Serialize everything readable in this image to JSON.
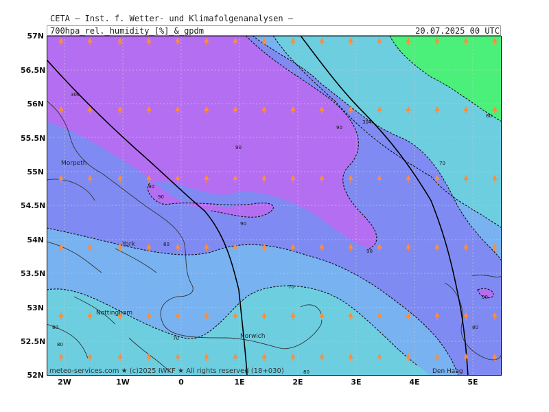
{
  "header": {
    "title": "CETA — Inst. f. Wetter- und Klimafolgenanalysen —",
    "field": "700hpa_rel._humidity_[%]_&_gpdm",
    "valid_time": "20.07.2025 00 UTC"
  },
  "footer": {
    "credit": "meteo-services.com ★ (c)2025 IWKF ★ All rights reserved (18+030)"
  },
  "axes": {
    "lat_ticks": [
      "57N",
      "56.5N",
      "56N",
      "55.5N",
      "55N",
      "54.5N",
      "54N",
      "53.5N",
      "53N",
      "52.5N",
      "52N"
    ],
    "lon_ticks": [
      "2W",
      "1W",
      "0",
      "1E",
      "2E",
      "3E",
      "4E",
      "5E"
    ]
  },
  "places": {
    "morpeth": "Morpeth",
    "york": "York",
    "nottingham": "Nottingham",
    "norwich": "Norwich",
    "den_haag": "Den Haag"
  },
  "contour_labels": {
    "c90_a": "90",
    "c90_b": "90",
    "c90_c": "90",
    "c90_d": "90",
    "c90_e": "90",
    "c90_f": "90",
    "c90_g": "90",
    "c80_a": "80",
    "c80_b": "80",
    "c80_c": "80",
    "c80_d": "80",
    "c70_a": "70",
    "c70_b": "70",
    "c70_c": "70",
    "c80_e": "80",
    "c80_f": "80",
    "gp_a": "306",
    "gp_b": "304"
  },
  "colors": {
    "rh_gt90": "#b46ef2",
    "rh_80_90": "#7f8bf2",
    "rh_70_80": "#78b2f0",
    "rh_60_70": "#6dcee0",
    "rh_lt60": "#4bf07a",
    "wind_arrow": "#ff8c3c"
  }
}
